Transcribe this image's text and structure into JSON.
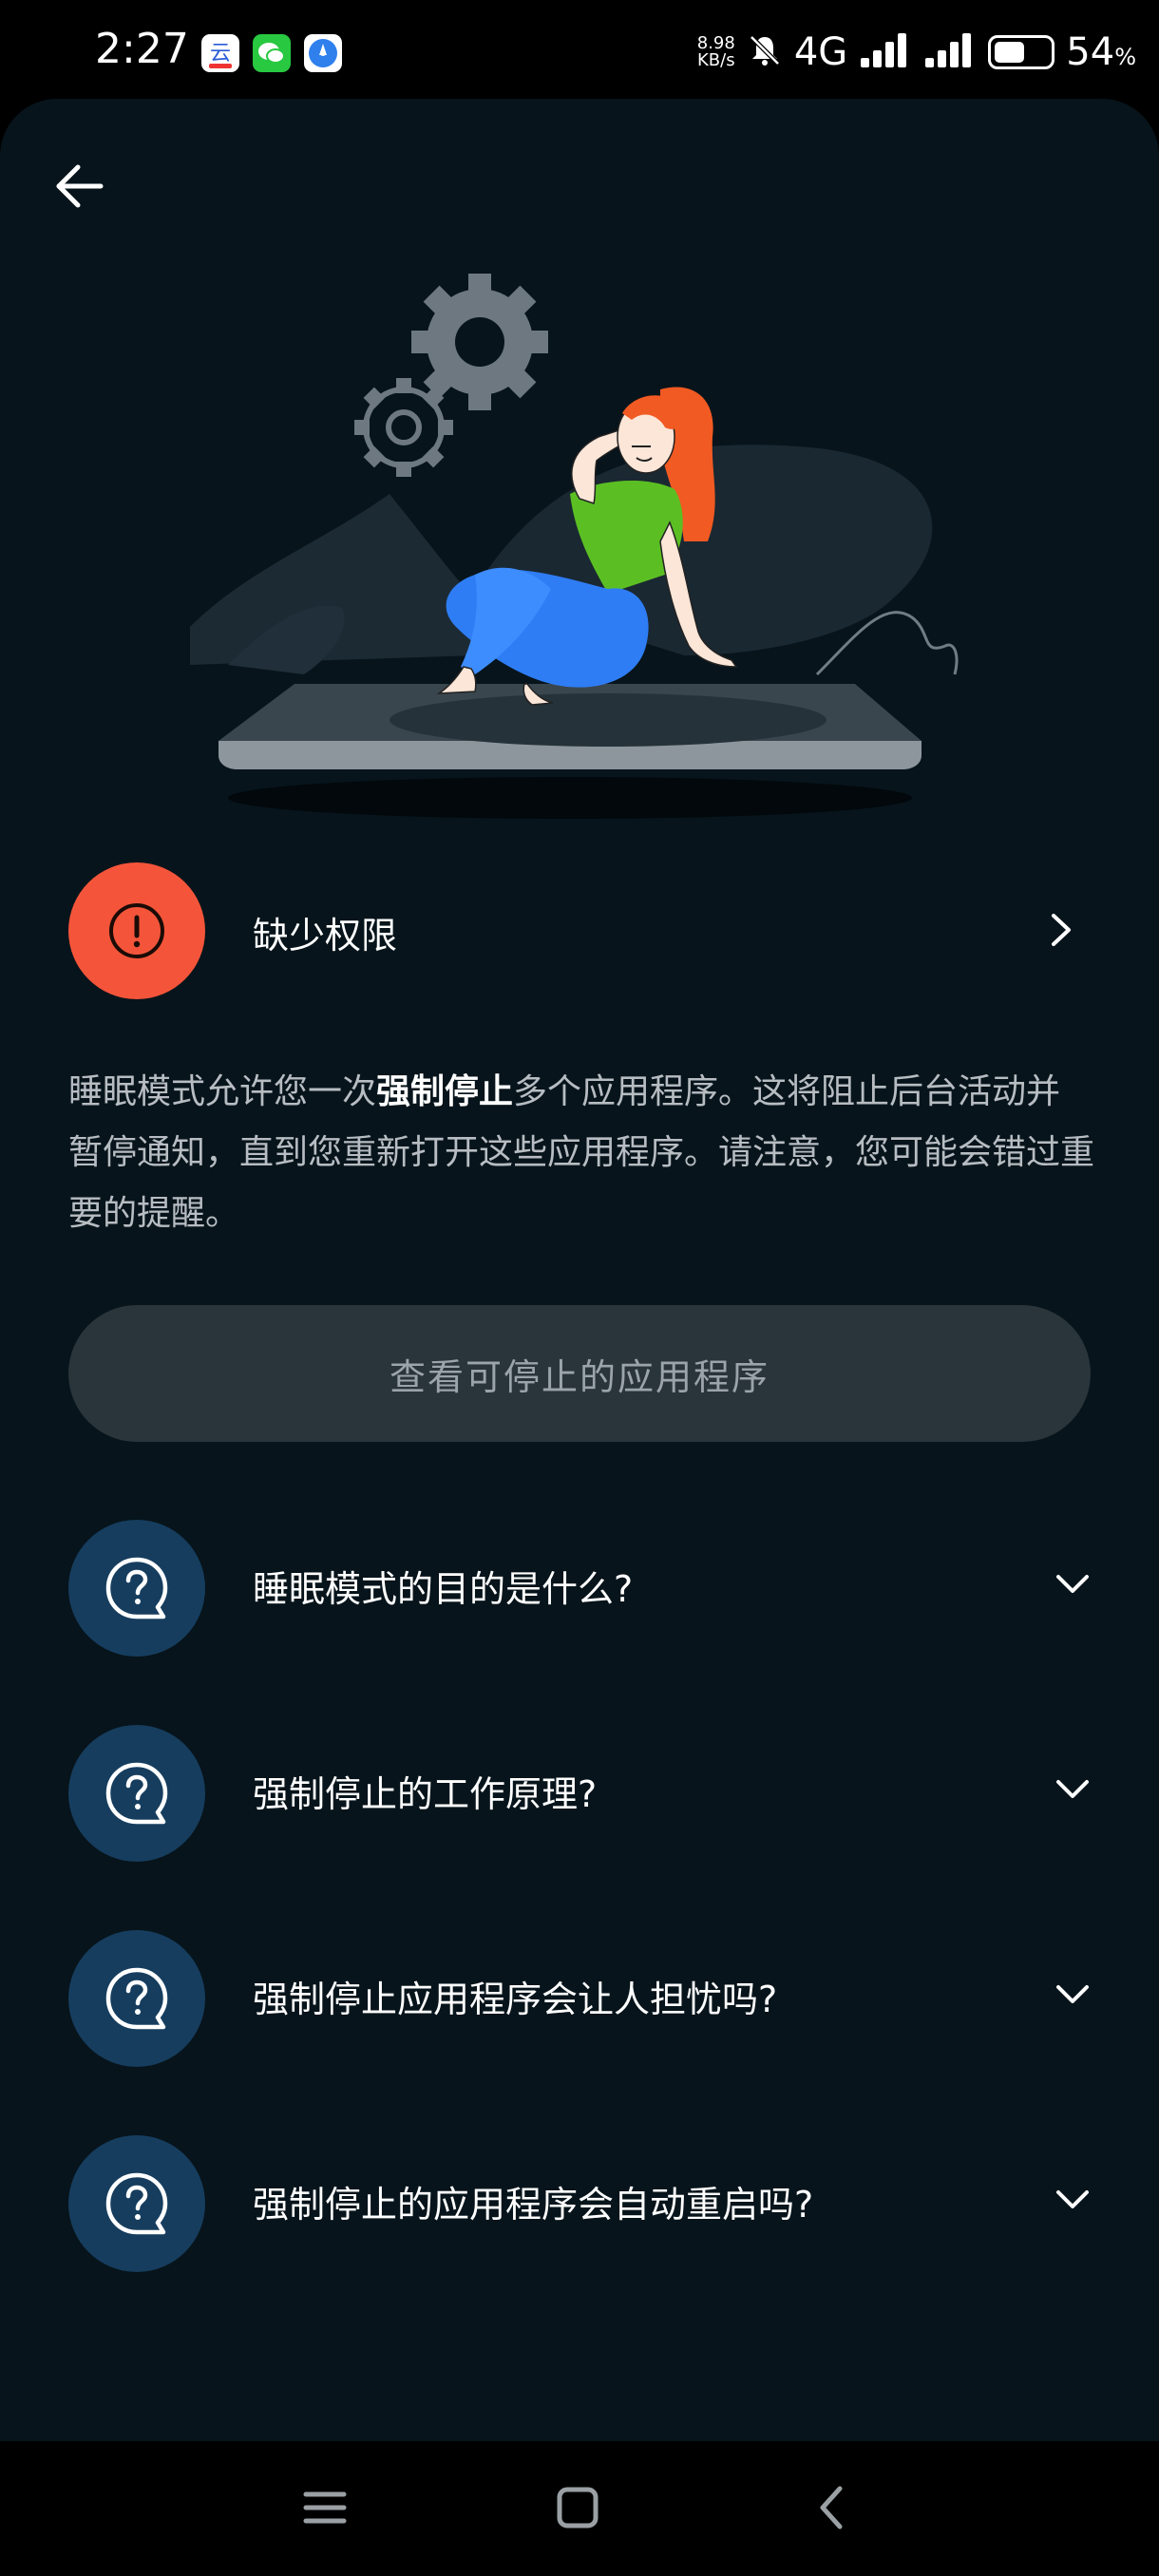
{
  "status_bar": {
    "time": "2:27",
    "app_icons": [
      {
        "name": "cloud-app-icon",
        "color": "#ffffff",
        "accent": "#2a5bd7"
      },
      {
        "name": "messages-app-icon",
        "color": "#28c840"
      },
      {
        "name": "compass-app-icon",
        "color": "#2f80ed"
      }
    ],
    "net_speed_value": "8.98",
    "net_speed_unit": "KB/s",
    "network": "4G",
    "battery_level": "54",
    "battery_unit": "%",
    "battery_fraction": 0.54
  },
  "header": {
    "back_icon": "arrow-left-icon"
  },
  "permission": {
    "label": "缺少权限",
    "icon": "exclamation-circle-icon",
    "color": "#f4553a"
  },
  "description": {
    "part1": "睡眠模式允许您一次",
    "bold": "强制停止",
    "part2": "多个应用程序。这将阻止后台活动并暂停通知，直到您重新打开这些应用程序。请注意，您可能会错过重要的提醒。"
  },
  "view_button": {
    "label": "查看可停止的应用程序"
  },
  "faq": [
    {
      "label": "睡眠模式的目的是什么?"
    },
    {
      "label": "强制停止的工作原理?"
    },
    {
      "label": "强制停止应用程序会让人担忧吗?"
    },
    {
      "label": "强制停止的应用程序会自动重启吗?"
    }
  ],
  "colors": {
    "background": "#07141b",
    "faq_circle": "#163d5e",
    "button": "#2a353b"
  }
}
